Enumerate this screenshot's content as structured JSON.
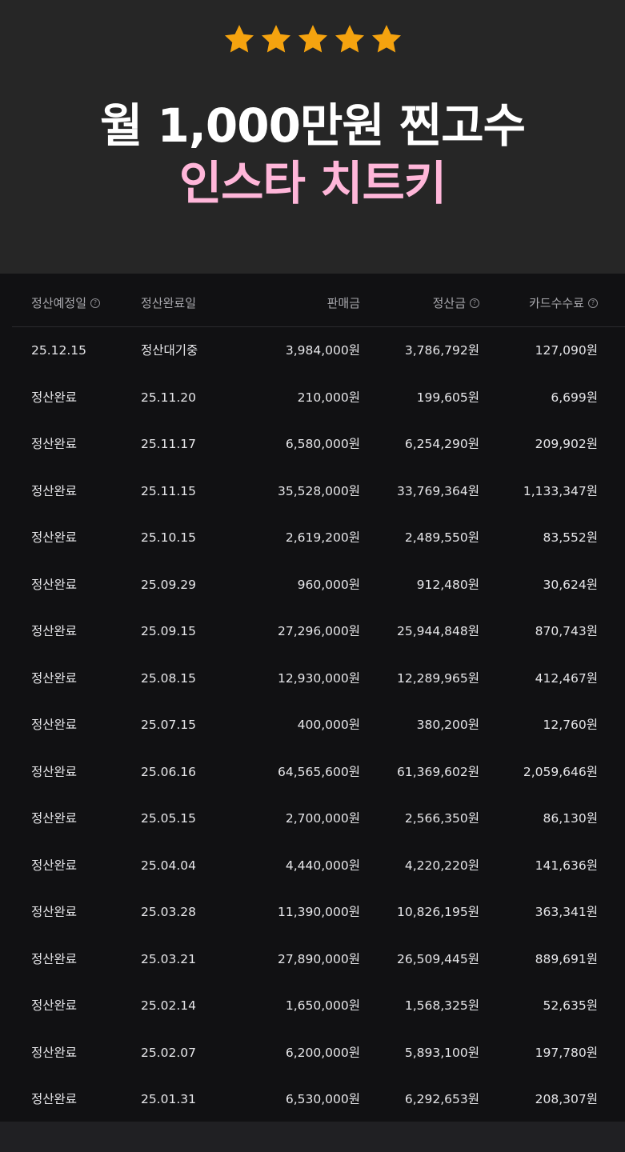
{
  "hero": {
    "stars_count": 5,
    "star_color": "#f5a30f",
    "title_line1": "월 1,000만원 찐고수",
    "title_line2": "인스타 치트키",
    "title_line2_color": "#ffb6d9"
  },
  "table": {
    "headers": [
      "정산예정일",
      "정산완료일",
      "판매금",
      "정산금",
      "카드수수료"
    ],
    "help_marker": "?",
    "rows": [
      [
        "25.12.15",
        "정산대기중",
        "3,984,000원",
        "3,786,792원",
        "127,090원"
      ],
      [
        "정산완료",
        "25.11.20",
        "210,000원",
        "199,605원",
        "6,699원"
      ],
      [
        "정산완료",
        "25.11.17",
        "6,580,000원",
        "6,254,290원",
        "209,902원"
      ],
      [
        "정산완료",
        "25.11.15",
        "35,528,000원",
        "33,769,364원",
        "1,133,347원"
      ],
      [
        "정산완료",
        "25.10.15",
        "2,619,200원",
        "2,489,550원",
        "83,552원"
      ],
      [
        "정산완료",
        "25.09.29",
        "960,000원",
        "912,480원",
        "30,624원"
      ],
      [
        "정산완료",
        "25.09.15",
        "27,296,000원",
        "25,944,848원",
        "870,743원"
      ],
      [
        "정산완료",
        "25.08.15",
        "12,930,000원",
        "12,289,965원",
        "412,467원"
      ],
      [
        "정산완료",
        "25.07.15",
        "400,000원",
        "380,200원",
        "12,760원"
      ],
      [
        "정산완료",
        "25.06.16",
        "64,565,600원",
        "61,369,602원",
        "2,059,646원"
      ],
      [
        "정산완료",
        "25.05.15",
        "2,700,000원",
        "2,566,350원",
        "86,130원"
      ],
      [
        "정산완료",
        "25.04.04",
        "4,440,000원",
        "4,220,220원",
        "141,636원"
      ],
      [
        "정산완료",
        "25.03.28",
        "11,390,000원",
        "10,826,195원",
        "363,341원"
      ],
      [
        "정산완료",
        "25.03.21",
        "27,890,000원",
        "26,509,445원",
        "889,691원"
      ],
      [
        "정산완료",
        "25.02.14",
        "1,650,000원",
        "1,568,325원",
        "52,635원"
      ],
      [
        "정산완료",
        "25.02.07",
        "6,200,000원",
        "5,893,100원",
        "197,780원"
      ],
      [
        "정산완료",
        "25.01.31",
        "6,530,000원",
        "6,292,653원",
        "208,307원"
      ]
    ]
  }
}
